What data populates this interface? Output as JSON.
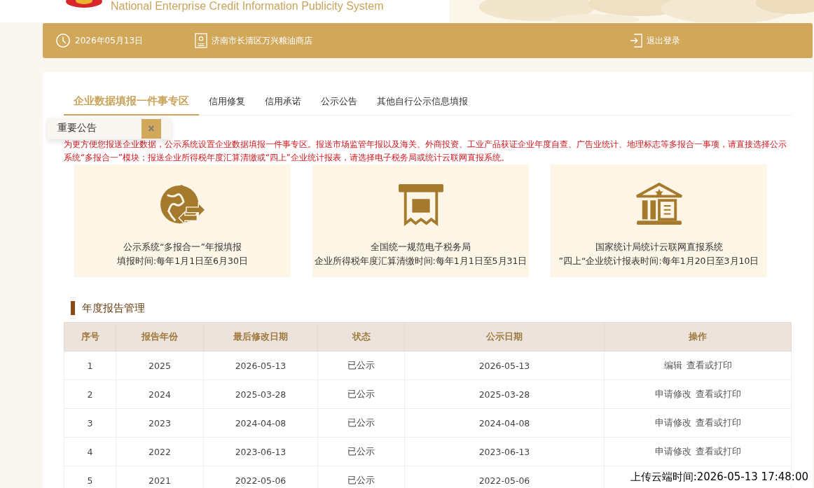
{
  "header": {
    "subtitle": "National Enterprise Credit Information Publicity System"
  },
  "info_bar": {
    "date": "2026年05月13日",
    "company": "济南市长清区万兴粮油商店",
    "logout": "退出登录"
  },
  "tabs": [
    {
      "label": "企业数据填报一件事专区",
      "selected": true
    },
    {
      "label": "信用修复",
      "selected": false
    },
    {
      "label": "信用承诺",
      "selected": false
    },
    {
      "label": "公示公告",
      "selected": false
    },
    {
      "label": "其他自行公示信息填报",
      "selected": false
    }
  ],
  "notice": "为更方便您报送企业数据，公示系统设置企业数据填报一件事专区。报送市场监管年报以及海关、外商投资、工业产品获证企业年度自查、广告业统计、地理标志等多报合一事项，请直接选择公示系统“多报合一”模块；报送企业所得税年度汇算清缴或“四上”企业统计报表，请选择电子税务局或统计云联网直报系统。",
  "popup": {
    "title": "重要公告",
    "close": "×"
  },
  "cards": [
    {
      "kind": "globe",
      "title": "公示系统“多报合一”年报填报",
      "time": "填报时间:每年1月1日至6月30日"
    },
    {
      "kind": "tax",
      "title": "全国统一规范电子税务局",
      "time": "企业所得税年度汇算清缴时间:每年1月1日至5月31日"
    },
    {
      "kind": "building",
      "title": "国家统计局统计云联网直报系统",
      "time": "”四上“企业统计报表时间:每年1月20日至3月10日"
    }
  ],
  "section_title": "年度报告管理",
  "table": {
    "columns": [
      "序号",
      "报告年份",
      "最后修改日期",
      "状态",
      "公示日期",
      "操作"
    ],
    "rows": [
      {
        "cells": [
          "1",
          "2025",
          "2026-05-13",
          "已公示",
          "2026-05-13"
        ],
        "actions": [
          "编辑",
          "查看或打印"
        ]
      },
      {
        "cells": [
          "2",
          "2024",
          "2025-03-28",
          "已公示",
          "2025-03-28"
        ],
        "actions": [
          "申请修改",
          "查看或打印"
        ]
      },
      {
        "cells": [
          "3",
          "2023",
          "2024-04-08",
          "已公示",
          "2024-04-08"
        ],
        "actions": [
          "申请修改",
          "查看或打印"
        ]
      },
      {
        "cells": [
          "4",
          "2022",
          "2023-06-13",
          "已公示",
          "2023-06-13"
        ],
        "actions": [
          "申请修改",
          "查看或打印"
        ]
      },
      {
        "cells": [
          "5",
          "2021",
          "2022-05-06",
          "已公示",
          "2022-05-06"
        ],
        "actions": []
      }
    ]
  },
  "timestamp": "上传云端时间:2026-05-13 17:48:00"
}
